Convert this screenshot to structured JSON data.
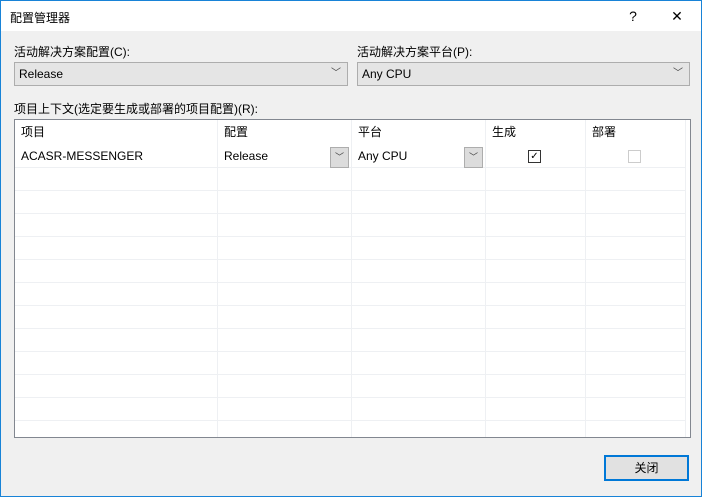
{
  "window": {
    "title": "配置管理器",
    "help": "?",
    "close": "✕"
  },
  "solution_config": {
    "label": "活动解决方案配置(C):",
    "value": "Release"
  },
  "solution_platform": {
    "label": "活动解决方案平台(P):",
    "value": "Any CPU"
  },
  "grid_label": "项目上下文(选定要生成或部署的项目配置)(R):",
  "columns": [
    "项目",
    "配置",
    "平台",
    "生成",
    "部署"
  ],
  "rows": [
    {
      "project": "ACASR-MESSENGER",
      "config": "Release",
      "platform": "Any CPU",
      "build": true,
      "deploy": false
    }
  ],
  "close_button": "关闭"
}
